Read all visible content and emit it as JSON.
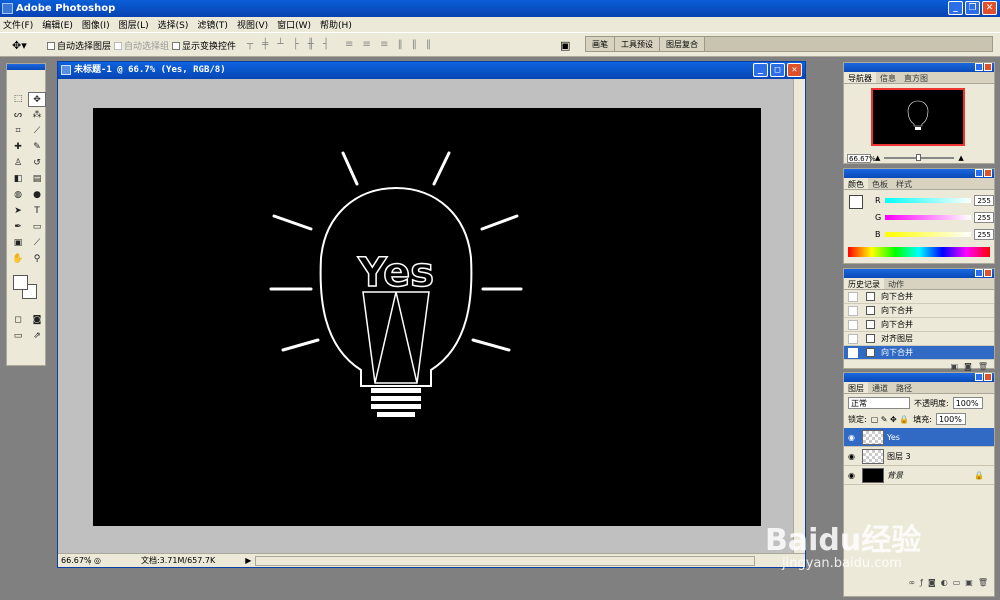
{
  "app": {
    "title": "Adobe Photoshop"
  },
  "menus": [
    "文件(F)",
    "编辑(E)",
    "图像(I)",
    "图层(L)",
    "选择(S)",
    "滤镜(T)",
    "视图(V)",
    "窗口(W)",
    "帮助(H)"
  ],
  "options": {
    "auto_select_layer": "自动选择图层",
    "auto_select_group": "自动选择组",
    "show_transform": "显示变换控件"
  },
  "well_tabs": [
    "画笔",
    "工具预设",
    "图层复合"
  ],
  "document": {
    "title": "未标题-1 @ 66.7% (Yes, RGB/8)",
    "zoom": "66.67%",
    "doc_size": "文档:3.71M/657.7K",
    "artwork_text": "Yes"
  },
  "navigator": {
    "tabs": [
      "导航器",
      "信息",
      "直方图"
    ],
    "zoom": "66.67%"
  },
  "color": {
    "tabs": [
      "颜色",
      "色板",
      "样式"
    ],
    "channels": [
      {
        "label": "R",
        "value": "255"
      },
      {
        "label": "G",
        "value": "255"
      },
      {
        "label": "B",
        "value": "255"
      }
    ]
  },
  "history": {
    "tabs": [
      "历史记录",
      "动作"
    ],
    "items": [
      "向下合并",
      "向下合并",
      "向下合并",
      "对齐图层",
      "向下合并"
    ],
    "selected_index": 4
  },
  "layers": {
    "tabs": [
      "图层",
      "通道",
      "路径"
    ],
    "blend_mode": "正常",
    "opacity_label": "不透明度:",
    "opacity": "100%",
    "lock_label": "锁定:",
    "fill_label": "填充:",
    "fill": "100%",
    "items": [
      {
        "name": "Yes",
        "selected": true
      },
      {
        "name": "图层 3",
        "selected": false
      },
      {
        "name": "背景",
        "selected": false,
        "locked": true
      }
    ]
  },
  "watermark": {
    "brand": "Baidu经验",
    "url": "jingyan.baidu.com"
  }
}
